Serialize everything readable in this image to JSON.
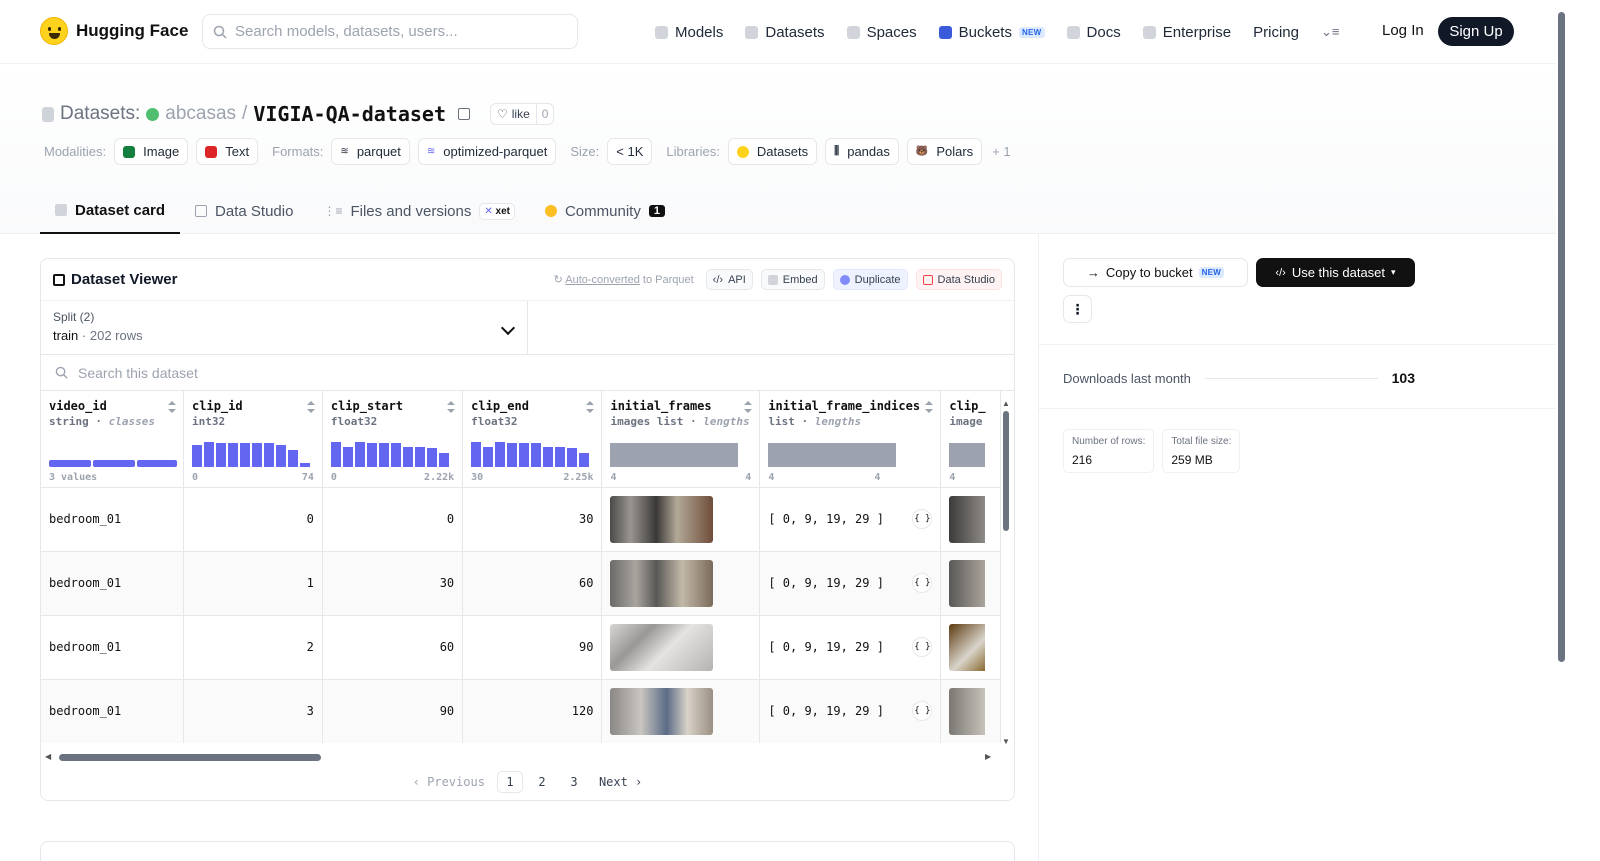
{
  "nav": {
    "brand": "Hugging Face",
    "search_placeholder": "Search models, datasets, users...",
    "links": [
      {
        "label": "Models",
        "icon": "models-icon"
      },
      {
        "label": "Datasets",
        "icon": "datasets-icon"
      },
      {
        "label": "Spaces",
        "icon": "spaces-icon"
      },
      {
        "label": "Buckets",
        "icon": "buckets-icon",
        "badge": "NEW"
      },
      {
        "label": "Docs",
        "icon": "docs-icon"
      },
      {
        "label": "Enterprise",
        "icon": "enterprise-icon"
      },
      {
        "label": "Pricing"
      }
    ],
    "login": "Log In",
    "signup": "Sign Up"
  },
  "header": {
    "crumb": "Datasets:",
    "owner": "abcasas",
    "slash": "/",
    "repo": "VIGIA-QA-dataset",
    "like_label": "like",
    "like_count": "0",
    "modalities_label": "Modalities:",
    "modalities": [
      "Image",
      "Text"
    ],
    "formats_label": "Formats:",
    "formats": [
      "parquet",
      "optimized-parquet"
    ],
    "size_label": "Size:",
    "size": "< 1K",
    "libraries_label": "Libraries:",
    "libraries": [
      "Datasets",
      "pandas",
      "Polars"
    ],
    "libraries_more": "+ 1"
  },
  "tabs": [
    {
      "label": "Dataset card",
      "active": true
    },
    {
      "label": "Data Studio"
    },
    {
      "label": "Files and versions",
      "badge": "xet"
    },
    {
      "label": "Community",
      "count": "1"
    }
  ],
  "viewer": {
    "title": "Dataset Viewer",
    "auto_converted": "Auto-converted",
    "to_parquet": "to Parquet",
    "buttons": [
      "API",
      "Embed",
      "Duplicate",
      "Data Studio"
    ],
    "split_label": "Split (2)",
    "split_value": "train",
    "split_rows": "202 rows",
    "search_placeholder": "Search this dataset",
    "columns": [
      {
        "name": "video_id",
        "type": "string",
        "kind": "classes",
        "range": [
          "3 values",
          ""
        ]
      },
      {
        "name": "clip_id",
        "type": "int32",
        "kind": "",
        "range": [
          "0",
          "74"
        ]
      },
      {
        "name": "clip_start",
        "type": "float32",
        "kind": "",
        "range": [
          "0",
          "2.22k"
        ]
      },
      {
        "name": "clip_end",
        "type": "float32",
        "kind": "",
        "range": [
          "30",
          "2.25k"
        ]
      },
      {
        "name": "initial_frames",
        "type": "images list",
        "kind": "lengths",
        "range": [
          "4",
          "4"
        ]
      },
      {
        "name": "initial_frame_indices",
        "type": "list",
        "kind": "lengths",
        "range": [
          "4",
          "4"
        ]
      },
      {
        "name": "clip_",
        "type": "image",
        "kind": "",
        "range": [
          "4",
          ""
        ]
      }
    ],
    "rows": [
      {
        "video_id": "bedroom_01",
        "clip_id": "0",
        "clip_start": "0",
        "clip_end": "30",
        "indices": "[ 0, 9, 19, 29 ]"
      },
      {
        "video_id": "bedroom_01",
        "clip_id": "1",
        "clip_start": "30",
        "clip_end": "60",
        "indices": "[ 0, 9, 19, 29 ]"
      },
      {
        "video_id": "bedroom_01",
        "clip_id": "2",
        "clip_start": "60",
        "clip_end": "90",
        "indices": "[ 0, 9, 19, 29 ]"
      },
      {
        "video_id": "bedroom_01",
        "clip_id": "3",
        "clip_start": "90",
        "clip_end": "120",
        "indices": "[ 0, 9, 19, 29 ]"
      }
    ],
    "json_btn": "{ }",
    "pager": {
      "prev": "‹ Previous",
      "pages": [
        "1",
        "2",
        "3"
      ],
      "current": "1",
      "next": "Next ›"
    }
  },
  "sidebar": {
    "copy_bucket": "Copy to bucket",
    "copy_badge": "NEW",
    "use_dataset": "Use this dataset",
    "kebab": "⋮",
    "downloads_label": "Downloads last month",
    "downloads_value": "103",
    "rows_label": "Number of rows:",
    "rows_value": "216",
    "filesize_label": "Total file size:",
    "filesize_value": "259 MB"
  },
  "colors": {
    "accent": "#6366f1",
    "brand": "#FFD21E",
    "dark": "#111827"
  }
}
